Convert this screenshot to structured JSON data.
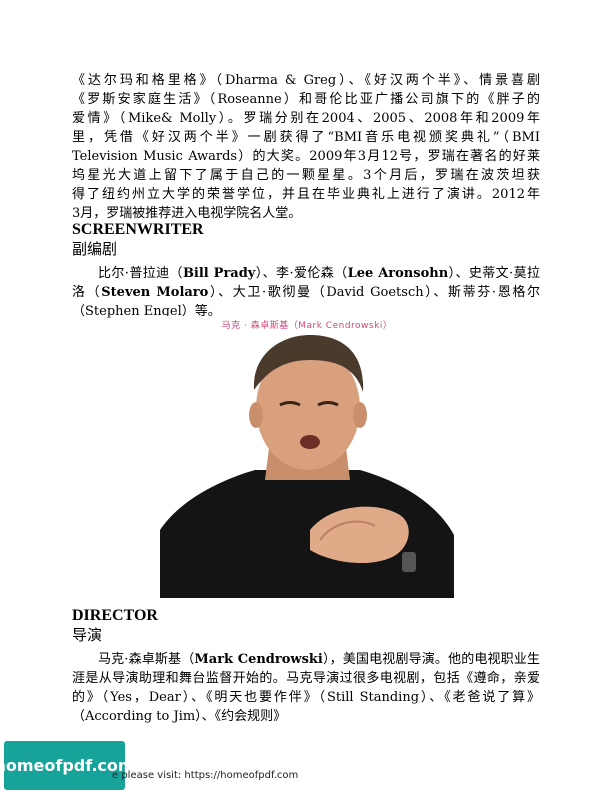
{
  "intro": {
    "l1": "《达尔玛和格里格》（Dharma & Greg）、《好汉两个半》、情景喜剧",
    "l2": "《罗斯安家庭生活》（Roseanne）和哥伦比亚广播公司旗下的《胖子的",
    "l3": "爱情》（Mike& Molly）。罗瑞分别在2004、2005、2008年和2009年",
    "l4": "里，凭借《好汉两个半》一剧获得了“BMI音乐电视颁奖典礼”（BMI",
    "l5": "Television Music Awards）的大奖。2009年3月12号，罗瑞在著名的好莱",
    "l6": "坞星光大道上留下了属于自己的一颗星星。3个月后，罗瑞在波茨坦获",
    "l7": "得了纽约州立大学的荣誉学位，并且在毕业典礼上进行了演讲。2012年",
    "l8": "3月，罗瑞被推荐进入电视学院名人堂。"
  },
  "screenwriter": {
    "heading_en": "SCREENWRITER",
    "heading_zh": "副编剧",
    "p1": "比尔·普拉迪（",
    "n1": "Bill Prady",
    "p2": "）、李·爱伦森（",
    "n2": "Lee Aronsohn",
    "p3": "）、史蒂文·莫拉洛（",
    "n3": "Steven Molaro",
    "p4": "）、大卫·歌彻曼（David Goetsch）、斯蒂芬·恩格尔（Stephen Engel）等。"
  },
  "photo": {
    "caption": "马克 · 森卓斯基（Mark Cendrowski）"
  },
  "director": {
    "heading_en": "DIRECTOR",
    "heading_zh": "导演",
    "p1": "马克·森卓斯基（",
    "n1": "Mark Cendrowski",
    "p2": "），美国电视剧导演。他的电视职业生涯是从导演助理和舞台监督开始的。马克导演过很多电视剧，包括《遵命，亲爱的》（Yes，Dear）、《明天也要作伴》（Still Standing）、《老爸说了算》（According to Jim）、《约会规则》"
  },
  "badge": {
    "text": "homeofpdf.com"
  },
  "footer": {
    "text": "e please visit: https://homeofpdf.com"
  }
}
